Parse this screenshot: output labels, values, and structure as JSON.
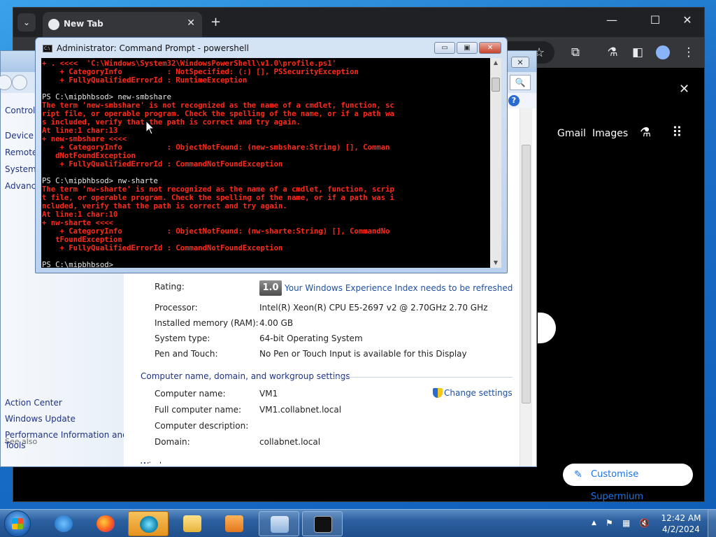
{
  "browser": {
    "tab_title": "New Tab",
    "new_tab_glyph": "+",
    "tab_close_glyph": "✕",
    "tab_search_glyph": "⌄",
    "min_glyph": "—",
    "max_glyph": "☐",
    "close_glyph": "✕",
    "gmail": "Gmail",
    "images": "Images",
    "customise": "Customise Supermium",
    "banner_close": "✕",
    "icons": [
      "star-icon",
      "extensions-icon",
      "labs-icon",
      "sidepanel-icon",
      "profile-icon",
      "menu-icon"
    ]
  },
  "system_window": {
    "close_glyph": "✕",
    "search_glyph": "🔍",
    "help_glyph": "?",
    "left_pane": {
      "control": "Control",
      "device": "Device M",
      "remote": "Remote",
      "system": "System p",
      "advanced": "Advance",
      "see_also": "See also",
      "action_center": "Action Center",
      "windows_update": "Windows Update",
      "perf_line1": "Performance Information and",
      "perf_line2": "Tools"
    },
    "rating_label": "Rating:",
    "wei_score": "1.0",
    "wei_link": "Your Windows Experience Index needs to be refreshed",
    "processor_label": "Processor:",
    "processor_value": "Intel(R) Xeon(R) CPU E5-2697 v2 @ 2.70GHz   2.70 GHz",
    "memory_label": "Installed memory (RAM):",
    "memory_value": "4.00 GB",
    "type_label": "System type:",
    "type_value": "64-bit Operating System",
    "pen_label": "Pen and Touch:",
    "pen_value": "No Pen or Touch Input is available for this Display",
    "section_title": "Computer name, domain, and workgroup settings",
    "name_label": "Computer name:",
    "name_value": "VM1",
    "full_label": "Full computer name:",
    "full_value": "VM1.collabnet.local",
    "desc_label": "Computer description:",
    "domain_label": "Domain:",
    "domain_value": "collabnet.local",
    "change_settings": "Change settings",
    "cut_heading": "Windows activation"
  },
  "cmd": {
    "title": "Administrator: Command Prompt - powershell",
    "icon_text": "C:\\",
    "min_glyph": "▭",
    "max_glyph": "▣",
    "close_glyph": "✕",
    "up_arrow": "▲",
    "down_arrow": "▼",
    "lines": [
      {
        "cls": "err",
        "text": "+ . <<<<  'C:\\Windows\\System32\\WindowsPowerShell\\v1.0\\profile.ps1'"
      },
      {
        "cls": "err",
        "text": "    + CategoryInfo          : NotSpecified: (:) [], PSSecurityException"
      },
      {
        "cls": "err",
        "text": "    + FullyQualifiedErrorId : RuntimeException"
      },
      {
        "cls": "ok",
        "text": ""
      },
      {
        "cls": "ok",
        "text": "PS C:\\mipbhbsod> new-smbshare"
      },
      {
        "cls": "err",
        "text": "The term 'new-smbshare' is not recognized as the name of a cmdlet, function, sc"
      },
      {
        "cls": "err",
        "text": "ript file, or operable program. Check the spelling of the name, or if a path wa"
      },
      {
        "cls": "err",
        "text": "s included, verify that the path is correct and try again."
      },
      {
        "cls": "err",
        "text": "At line:1 char:13"
      },
      {
        "cls": "err",
        "text": "+ new-smbshare <<<<"
      },
      {
        "cls": "err",
        "text": "    + CategoryInfo          : ObjectNotFound: (new-smbshare:String) [], Comman"
      },
      {
        "cls": "err",
        "text": "   dNotFoundException"
      },
      {
        "cls": "err",
        "text": "    + FullyQualifiedErrorId : CommandNotFoundException"
      },
      {
        "cls": "ok",
        "text": ""
      },
      {
        "cls": "ok",
        "text": "PS C:\\mipbhbsod> nw-sharte"
      },
      {
        "cls": "err",
        "text": "The term 'nw-sharte' is not recognized as the name of a cmdlet, function, scrip"
      },
      {
        "cls": "err",
        "text": "t file, or operable program. Check the spelling of the name, or if a path was i"
      },
      {
        "cls": "err",
        "text": "ncluded, verify that the path is correct and try again."
      },
      {
        "cls": "err",
        "text": "At line:1 char:10"
      },
      {
        "cls": "err",
        "text": "+ nw-sharte <<<<"
      },
      {
        "cls": "err",
        "text": "    + CategoryInfo          : ObjectNotFound: (nw-sharte:String) [], CommandNo"
      },
      {
        "cls": "err",
        "text": "   tFoundException"
      },
      {
        "cls": "err",
        "text": "    + FullyQualifiedErrorId : CommandNotFoundException"
      },
      {
        "cls": "ok",
        "text": ""
      },
      {
        "cls": "ok",
        "text": "PS C:\\mipbhbsod>"
      }
    ]
  },
  "taskbar": {
    "time": "12:42 AM",
    "date": "4/2/2024",
    "tray_arrow": "▲",
    "apps": [
      "internet-explorer",
      "firefox",
      "supermium",
      "file-explorer",
      "media-player",
      "system-control-panel",
      "command-prompt"
    ]
  }
}
